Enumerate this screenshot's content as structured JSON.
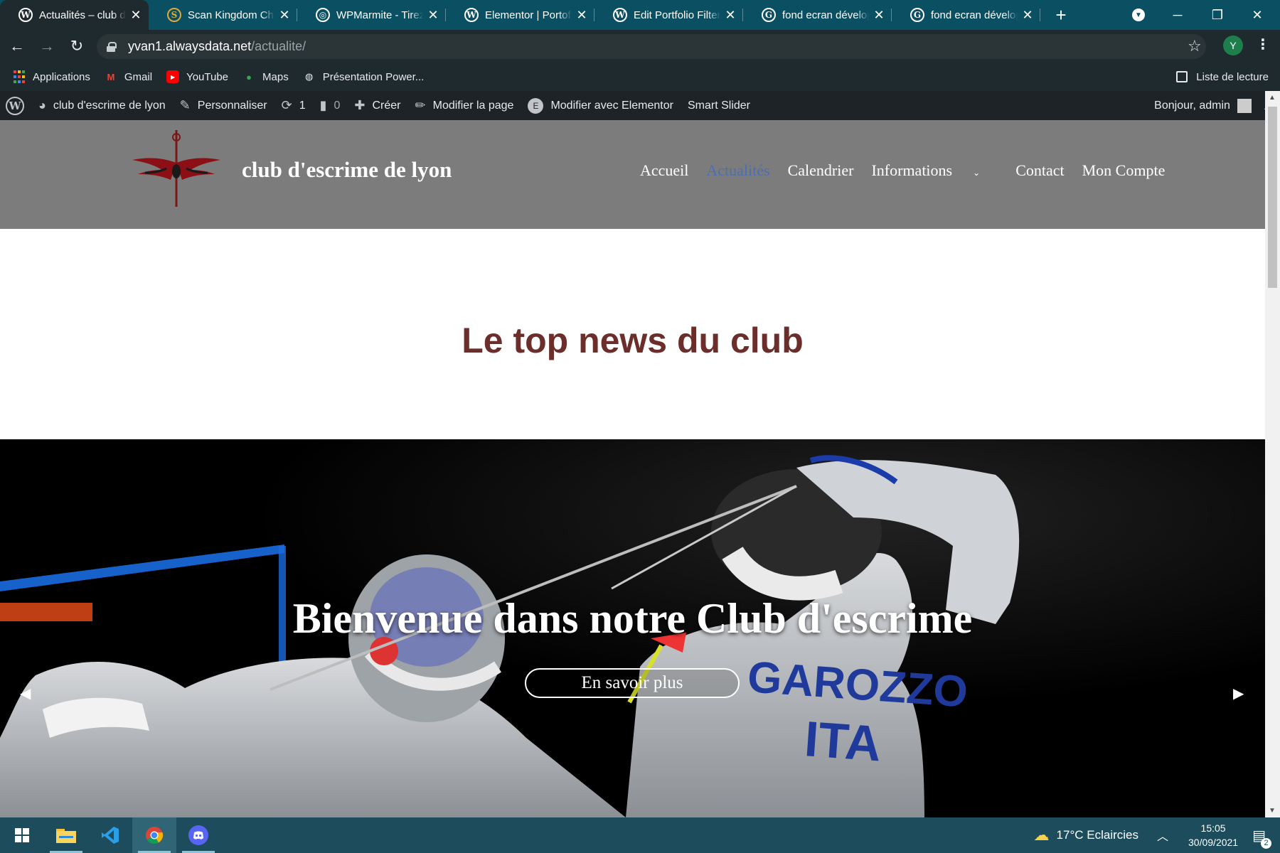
{
  "browser": {
    "tabs": [
      {
        "title": "Actualités – club d'escrime de lyon",
        "favicon": "wordpress-icon",
        "active": true
      },
      {
        "title": "Scan Kingdom Chapitre",
        "favicon": "scan-icon",
        "active": false
      },
      {
        "title": "WPMarmite - Tirez",
        "favicon": "wpmarmite-icon",
        "active": false
      },
      {
        "title": "Elementor | Portofolio",
        "favicon": "wordpress-icon",
        "active": false
      },
      {
        "title": "Edit Portfolio Filter",
        "favicon": "wordpress-icon",
        "active": false
      },
      {
        "title": "fond ecran développeur",
        "favicon": "google-icon",
        "active": false
      },
      {
        "title": "fond ecran développeur",
        "favicon": "google-icon",
        "active": false
      }
    ],
    "new_tab": "+",
    "address": {
      "host": "yvan1.alwaysdata.net",
      "path": "/actualite/"
    },
    "profile_initial": "Y",
    "bookmarks": [
      {
        "label": "Applications",
        "icon": "apps-grid-icon"
      },
      {
        "label": "Gmail",
        "icon": "gmail-icon"
      },
      {
        "label": "YouTube",
        "icon": "youtube-icon"
      },
      {
        "label": "Maps",
        "icon": "maps-icon"
      },
      {
        "label": "Présentation Power...",
        "icon": "globe-icon"
      }
    ],
    "reading_list": "Liste de lecture"
  },
  "wp_admin_bar": {
    "site_name": "club d'escrime de lyon",
    "customize": "Personnaliser",
    "updates_count": "1",
    "comments_count": "0",
    "create": "Créer",
    "edit_page": "Modifier la page",
    "edit_elementor": "Modifier avec Elementor",
    "smart_slider": "Smart Slider",
    "greeting": "Bonjour, admin"
  },
  "site": {
    "title": "club d'escrime de lyon",
    "nav": [
      {
        "label": "Accueil",
        "current": false
      },
      {
        "label": "Actualités",
        "current": true
      },
      {
        "label": "Calendrier",
        "current": false
      },
      {
        "label": "Informations",
        "current": false,
        "dropdown": true
      },
      {
        "label": "Contact",
        "current": false
      },
      {
        "label": "Mon Compte",
        "current": false
      }
    ],
    "heading": "Le top news du club",
    "slider": {
      "title": "Bienvenue dans notre Club d'escrime",
      "button": "En savoir plus",
      "jersey_text": "GAROZZO",
      "jersey_country": "ITA"
    }
  },
  "taskbar": {
    "apps": [
      "windows-start-icon",
      "file-explorer-icon",
      "vscode-icon",
      "chrome-icon",
      "discord-icon"
    ],
    "weather": "17°C  Eclaircies",
    "time": "15:05",
    "date": "30/09/2021",
    "notifications": "2"
  },
  "colors": {
    "tab_bar": "#0b4f63",
    "chrome_dark": "#1f2a2e",
    "wp_admin": "#1d2327",
    "site_header": "#7c7c7c",
    "heading": "#6b2e2a",
    "nav_current": "#4a6fb5"
  }
}
